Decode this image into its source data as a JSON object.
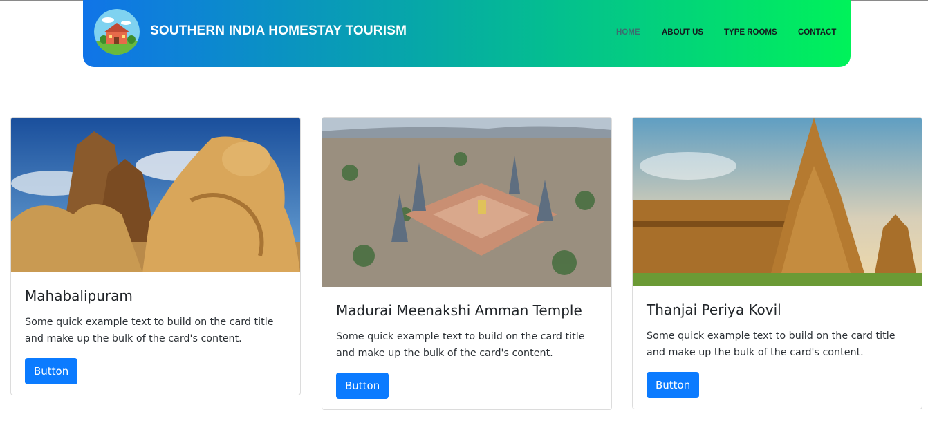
{
  "header": {
    "brand": "SOUTHERN INDIA HOMESTAY TOURISM",
    "logo_icon": "homestay-house-logo-icon",
    "nav": [
      {
        "label": "HOME",
        "active": true
      },
      {
        "label": "ABOUT US",
        "active": false
      },
      {
        "label": "TYPE ROOMS",
        "active": false
      },
      {
        "label": "CONTACT",
        "active": false
      }
    ],
    "gradient_colors": [
      "#1074e8",
      "#06a9a6",
      "#00f25a"
    ]
  },
  "cards": [
    {
      "title": "Mahabalipuram",
      "text": "Some quick example text to build on the card title and make up the bulk of the card's content.",
      "button": "Button",
      "image_icon": "shore-temple-photo"
    },
    {
      "title": "Madurai Meenakshi Amman Temple",
      "text": "Some quick example text to build on the card title and make up the bulk of the card's content.",
      "button": "Button",
      "image_icon": "meenakshi-temple-aerial-photo"
    },
    {
      "title": "Thanjai Periya Kovil",
      "text": "Some quick example text to build on the card title and make up the bulk of the card's content.",
      "button": "Button",
      "image_icon": "brihadeeswarar-temple-photo"
    }
  ],
  "colors": {
    "button": "#0b7bff",
    "brand_text": "#ffffff"
  }
}
